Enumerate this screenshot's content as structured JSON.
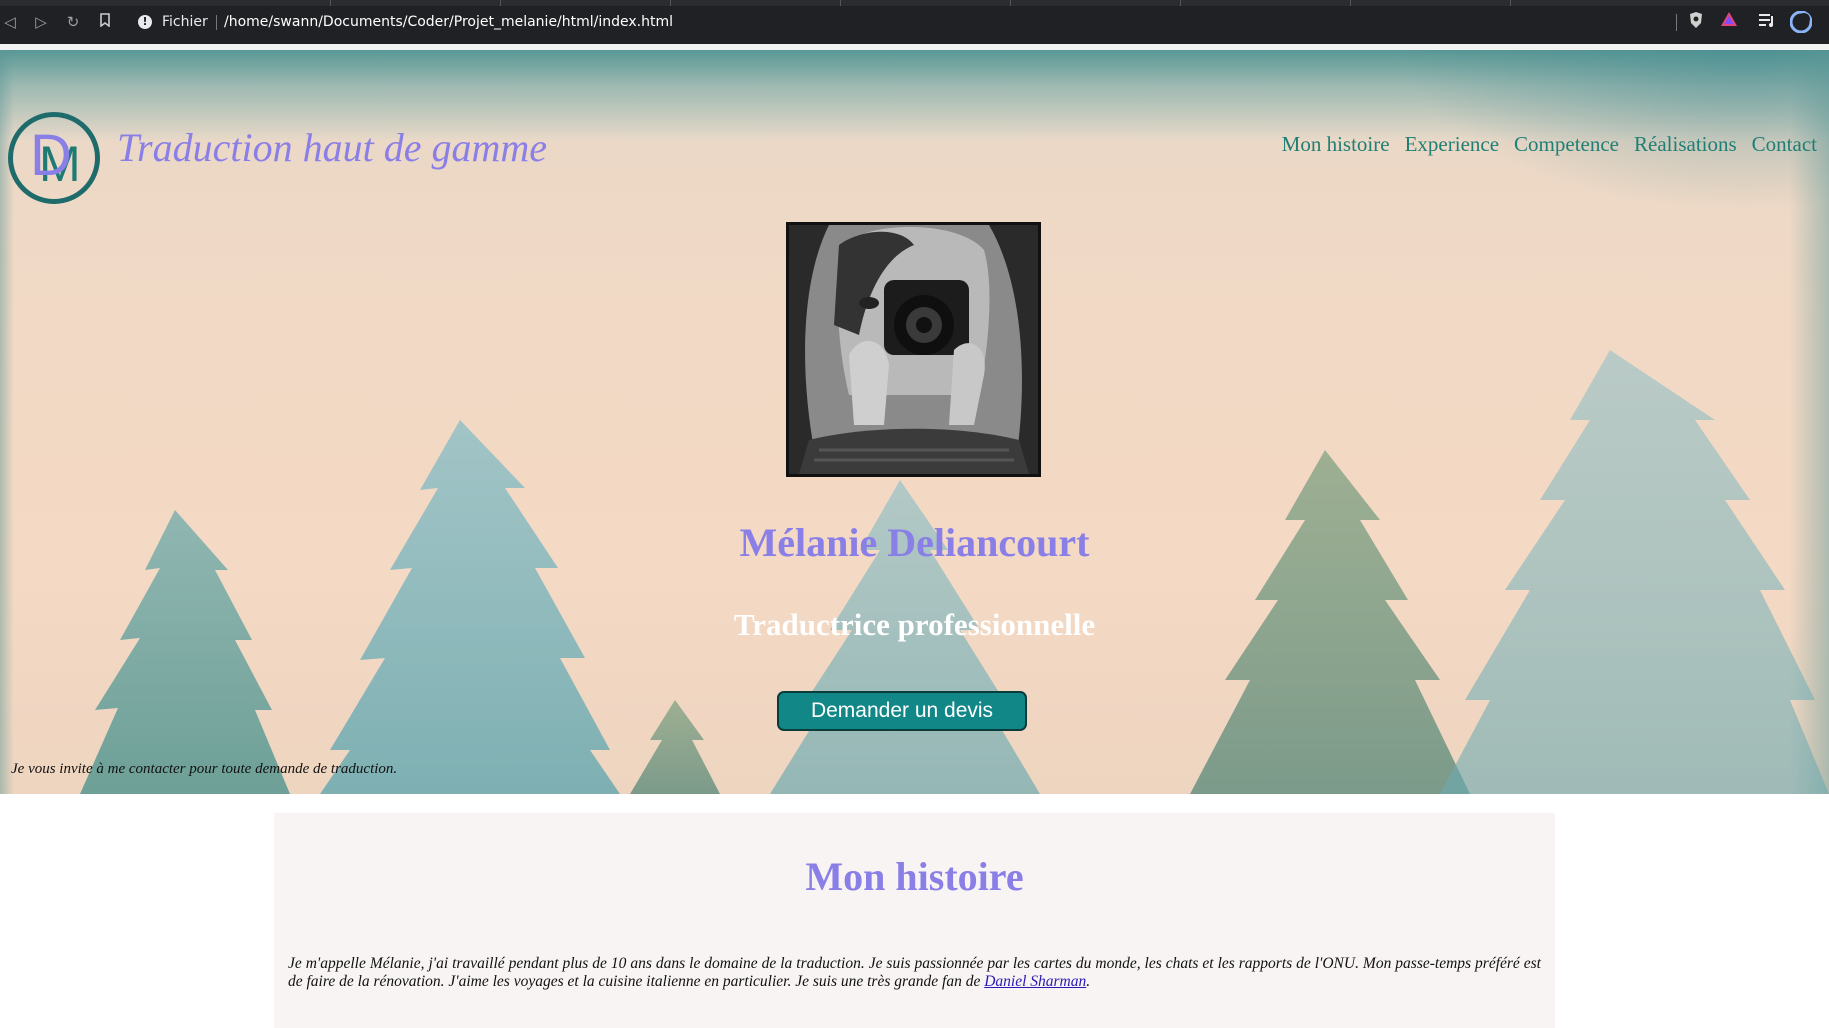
{
  "browser": {
    "url_scheme_label": "Fichier",
    "url": "/home/swann/Documents/Coder/Projet_melanie/html/index.html",
    "icons": [
      "back-icon",
      "forward-icon",
      "reload-icon",
      "bookmark-icon",
      "info-icon",
      "brave-shield-icon",
      "brave-rewards-icon",
      "playlist-icon",
      "profile-icon"
    ]
  },
  "header": {
    "logo_letters": [
      "D",
      "M"
    ],
    "tagline": "Traduction haut de gamme",
    "nav": [
      "Mon histoire",
      "Experience",
      "Competence",
      "Réalisations",
      "Contact"
    ]
  },
  "hero": {
    "name": "Mélanie Deliancourt",
    "subtitle": "Traductrice professionnelle",
    "cta_label": "Demander un devis",
    "invite_text": "Je vous invite à me contacter pour toute demande de traduction."
  },
  "story": {
    "title": "Mon histoire",
    "text_before_link": "Je m'appelle Mélanie, j'ai travaillé pendant plus de 10 ans dans le domaine de la traduction. Je suis passionnée par les cartes du monde, les chats et les rapports de l'ONU. Mon passe-temps préféré est de faire de la rénovation. J'aime les voyages et la cuisine italienne en particulier. Je suis une très grande fan de ",
    "link_text": "Daniel Sharman",
    "text_after_link": "."
  },
  "colors": {
    "accent_purple": "#8a7fe6",
    "teal_nav": "#1f7f75",
    "button_teal": "#128787",
    "hero_bg": "#f1d9c5",
    "section_bg": "#f8f4f3"
  }
}
